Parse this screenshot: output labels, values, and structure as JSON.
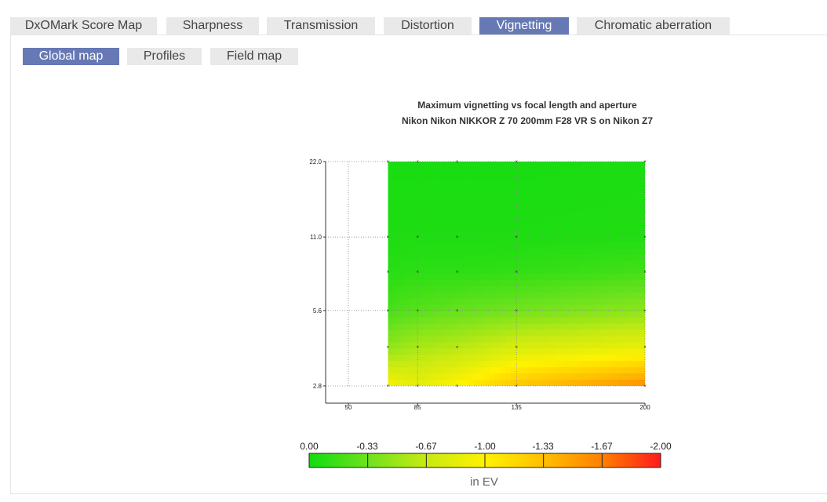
{
  "tabs": [
    "DxOMark Score Map",
    "Sharpness",
    "Transmission",
    "Distortion",
    "Vignetting",
    "Chromatic aberration"
  ],
  "active_tab": "Vignetting",
  "subtabs": [
    "Global map",
    "Profiles",
    "Field map"
  ],
  "active_subtab": "Global map",
  "chart": {
    "title_line1": "Maximum vignetting vs focal length and aperture",
    "title_line2": "Nikon Nikon NIKKOR Z 70 200mm F28 VR S on Nikon Z7"
  },
  "chart_data": {
    "type": "heatmap",
    "title": "Maximum vignetting vs focal length and aperture",
    "subtitle": "Nikon Nikon NIKKOR Z 70 200mm F28 VR S on Nikon Z7",
    "x_ticks": [
      "50",
      "85",
      "135",
      "200"
    ],
    "y_ticks": [
      "2.8",
      "5.6",
      "11.0",
      "22.0"
    ],
    "xlim": [
      50,
      200
    ],
    "ylim": [
      2.8,
      22.0
    ],
    "y_scale": "log",
    "x": [
      70,
      85,
      105,
      135,
      200
    ],
    "y": [
      2.8,
      4,
      5.6,
      8,
      11,
      22
    ],
    "values": [
      [
        -0.95,
        -0.85,
        -1.0,
        -1.3,
        -1.6
      ],
      [
        -0.45,
        -0.55,
        -0.6,
        -0.75,
        -0.85
      ],
      [
        -0.2,
        -0.25,
        -0.3,
        -0.35,
        -0.45
      ],
      [
        -0.08,
        -0.1,
        -0.1,
        -0.12,
        -0.18
      ],
      [
        -0.05,
        -0.05,
        -0.05,
        -0.05,
        -0.06
      ],
      [
        -0.03,
        -0.03,
        -0.03,
        -0.03,
        -0.04
      ]
    ],
    "colorbar": {
      "labels": [
        "0.00",
        "-0.33",
        "-0.67",
        "-1.00",
        "-1.33",
        "-1.67",
        "-2.00"
      ],
      "unit": "in EV",
      "colors": [
        "#10dc10",
        "#6ee21e",
        "#c8ea12",
        "#fff200",
        "#ffbf00",
        "#ff8000",
        "#ff1a1a"
      ]
    }
  }
}
